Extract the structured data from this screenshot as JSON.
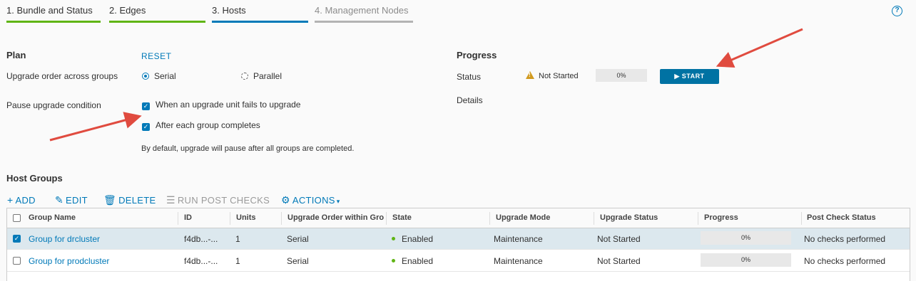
{
  "steps": [
    {
      "label": "1. Bundle and Status",
      "state": "done"
    },
    {
      "label": "2. Edges",
      "state": "done"
    },
    {
      "label": "3. Hosts",
      "state": "active"
    },
    {
      "label": "4. Management Nodes",
      "state": "future"
    }
  ],
  "help": {
    "icon": "help-icon",
    "glyph": "?"
  },
  "plan": {
    "title": "Plan",
    "reset": "RESET",
    "order_label": "Upgrade order across groups",
    "serial": "Serial",
    "parallel": "Parallel",
    "selected_order": "Serial",
    "pause_label": "Pause upgrade condition",
    "pause_fail": "When an upgrade unit fails to upgrade",
    "pause_group": "After each group completes",
    "note": "By default, upgrade will pause after all groups are completed."
  },
  "progress": {
    "title": "Progress",
    "status_label": "Status",
    "status_value": "Not Started",
    "percent": "0%",
    "start_label": "▶ START",
    "details_label": "Details"
  },
  "host_groups": {
    "title": "Host Groups",
    "toolbar": {
      "add": "ADD",
      "edit": "EDIT",
      "delete": "DELETE",
      "run_post_checks": "RUN POST CHECKS",
      "actions": "ACTIONS"
    },
    "columns": [
      "Group Name",
      "ID",
      "Units",
      "Upgrade Order within Gro",
      "State",
      "Upgrade Mode",
      "Upgrade Status",
      "Progress",
      "Post Check Status"
    ],
    "rows": [
      {
        "selected": true,
        "name": "Group for drcluster",
        "id": "f4db...-...",
        "units": "1",
        "order": "Serial",
        "state": "Enabled",
        "mode": "Maintenance",
        "status": "Not Started",
        "progress": "0%",
        "post_check": "No checks performed"
      },
      {
        "selected": false,
        "name": "Group for prodcluster",
        "id": "f4db...-...",
        "units": "1",
        "order": "Serial",
        "state": "Enabled",
        "mode": "Maintenance",
        "status": "Not Started",
        "progress": "0%",
        "post_check": "No checks performed"
      }
    ]
  },
  "colors": {
    "accent": "#0079b8",
    "done": "#60b515",
    "warning": "#d19a1f",
    "arrow": "#e04b3f"
  }
}
